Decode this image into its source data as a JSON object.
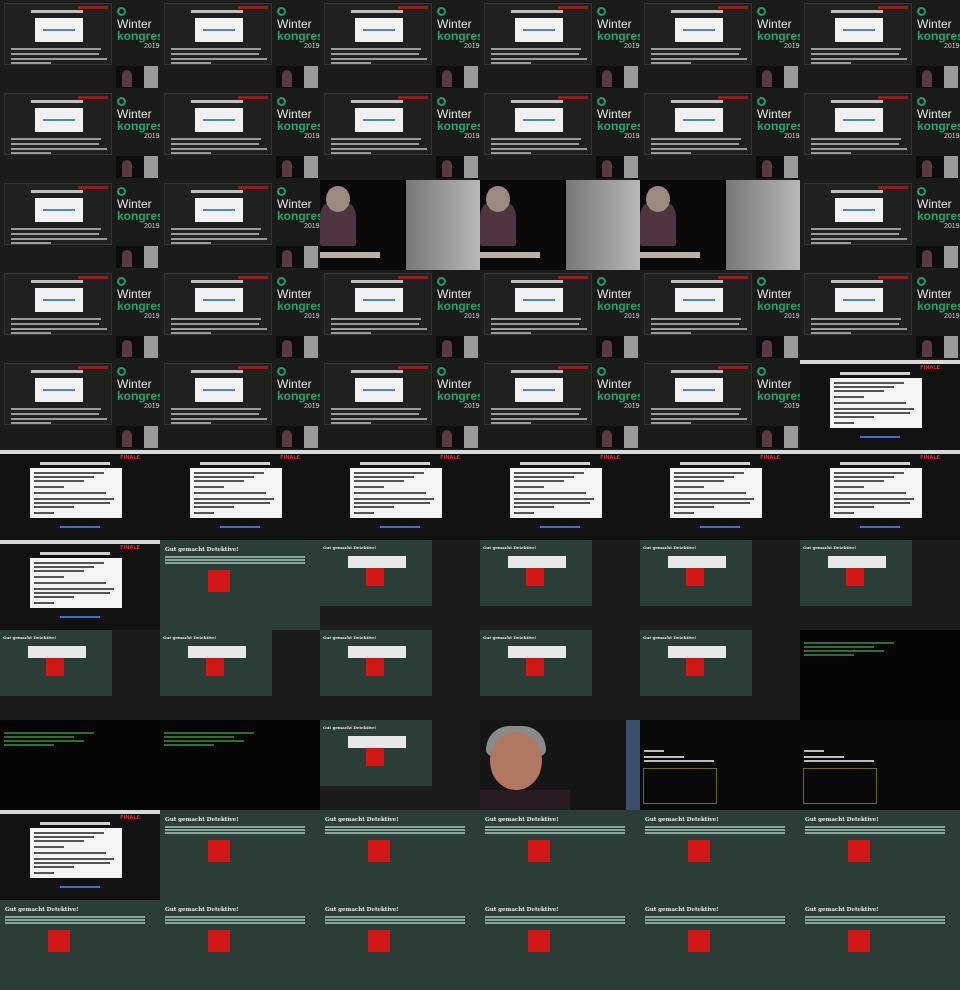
{
  "kongress": {
    "word1": "Winter",
    "word2": "kongress",
    "year": "2019"
  },
  "finale": {
    "label": "FINALE"
  },
  "green": {
    "title": "Gut gemacht Detektive!"
  },
  "tiles": [
    "kongress",
    "kongress",
    "kongress",
    "kongress",
    "kongress",
    "kongress",
    "kongress",
    "kongress",
    "kongress",
    "kongress",
    "kongress",
    "kongress",
    "kongress",
    "kongress",
    "stage",
    "stage",
    "stage",
    "kongress",
    "kongress",
    "kongress",
    "kongress",
    "kongress",
    "kongress",
    "kongress",
    "kongress",
    "kongress",
    "kongress",
    "kongress",
    "kongress",
    "finale",
    "finale",
    "finale",
    "finale",
    "finale",
    "finale",
    "finale",
    "finale",
    "green",
    "gk",
    "gk",
    "gk",
    "gk",
    "gk",
    "gk",
    "gk",
    "gk",
    "gk",
    "term",
    "term",
    "term",
    "gk",
    "face",
    "redhl",
    "redhl",
    "finale",
    "green",
    "green",
    "green",
    "green",
    "green",
    "green",
    "green",
    "green",
    "green",
    "green",
    "green"
  ]
}
